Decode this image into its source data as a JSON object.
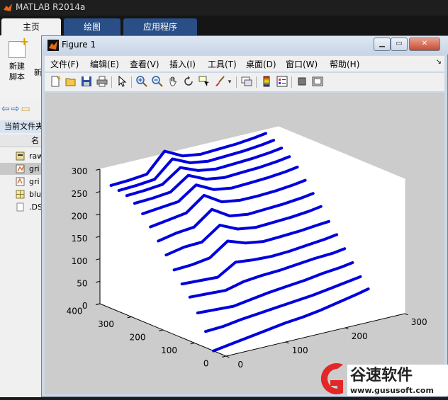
{
  "app": {
    "title": "MATLAB R2014a"
  },
  "ribbon": {
    "tabs": [
      {
        "label": "主页"
      },
      {
        "label": "绘图"
      },
      {
        "label": "应用程序"
      }
    ],
    "new_script": {
      "line1": "新建",
      "line2": "脚本"
    },
    "new_partial": "新"
  },
  "file_browser": {
    "label": "当前文件夹",
    "column_header": "名",
    "files": [
      {
        "name": "raw"
      },
      {
        "name": "gri"
      },
      {
        "name": "gri"
      },
      {
        "name": "blu"
      },
      {
        "name": ".DS"
      }
    ]
  },
  "figure": {
    "title": "Figure 1",
    "window_buttons": {
      "minimize": "▁",
      "restore": "▭",
      "close": "✕"
    },
    "menu": [
      {
        "label": "文件(F)"
      },
      {
        "label": "编辑(E)"
      },
      {
        "label": "查看(V)"
      },
      {
        "label": "插入(I)"
      },
      {
        "label": "工具(T)"
      },
      {
        "label": "桌面(D)"
      },
      {
        "label": "窗口(W)"
      },
      {
        "label": "帮助(H)"
      }
    ],
    "menu_arrow": "↘",
    "toolbar_icons": [
      "new-figure-icon",
      "open-file-icon",
      "save-icon",
      "print-icon",
      "select-arrow-icon",
      "zoom-in-icon",
      "zoom-out-icon",
      "pan-hand-icon",
      "rotate-3d-icon",
      "data-cursor-icon",
      "brush-icon",
      "brush-dropdown-icon",
      "link-plot-icon",
      "colorbar-icon",
      "legend-icon",
      "hide-plot-tools-icon",
      "show-plot-tools-icon"
    ]
  },
  "chart_data": {
    "type": "line",
    "projection": "3d",
    "title": "",
    "xlabel": "",
    "ylabel": "",
    "zlabel": "",
    "x_ticks": [
      "0",
      "100",
      "200",
      "300"
    ],
    "y_ticks": [
      "0",
      "100",
      "200",
      "300",
      "400"
    ],
    "z_ticks": [
      "0",
      "50",
      "100",
      "150",
      "200",
      "250",
      "300"
    ],
    "xlim": [
      0,
      300
    ],
    "ylim": [
      0,
      400
    ],
    "zlim": [
      0,
      300
    ],
    "grid": false,
    "legend": "none",
    "line_color": "#0000dd",
    "series": [
      {
        "y": 40,
        "x": [
          0,
          30,
          60,
          90,
          120,
          150,
          180,
          210,
          240,
          260
        ],
        "z": [
          0,
          6,
          12,
          18,
          24,
          28,
          34,
          42,
          50,
          56
        ]
      },
      {
        "y": 65,
        "x": [
          0,
          30,
          60,
          90,
          120,
          150,
          180,
          210,
          240,
          260
        ],
        "z": [
          36,
          38,
          44,
          48,
          52,
          56,
          60,
          66,
          72,
          76
        ]
      },
      {
        "y": 90,
        "x": [
          0,
          30,
          60,
          90,
          120,
          150,
          180,
          210,
          240,
          260
        ],
        "z": [
          70,
          68,
          66,
          72,
          78,
          82,
          86,
          92,
          96,
          100
        ]
      },
      {
        "y": 115,
        "x": [
          0,
          30,
          60,
          90,
          120,
          150,
          180,
          210,
          240,
          260
        ],
        "z": [
          98,
          96,
          94,
          104,
          108,
          110,
          114,
          118,
          120,
          124
        ]
      },
      {
        "y": 140,
        "x": [
          0,
          30,
          60,
          90,
          120,
          150,
          180,
          210,
          240,
          260
        ],
        "z": [
          120,
          118,
          116,
          140,
          136,
          134,
          136,
          140,
          144,
          148
        ]
      },
      {
        "y": 165,
        "x": [
          0,
          30,
          60,
          90,
          120,
          150,
          180,
          210,
          240,
          260
        ],
        "z": [
          144,
          146,
          152,
          180,
          166,
          160,
          162,
          164,
          168,
          170
        ]
      },
      {
        "y": 190,
        "x": [
          0,
          30,
          60,
          90,
          120,
          150,
          180,
          210,
          240,
          260
        ],
        "z": [
          170,
          178,
          180,
          208,
          190,
          184,
          186,
          188,
          192,
          196
        ]
      },
      {
        "y": 215,
        "x": [
          0,
          30,
          60,
          90,
          120,
          150,
          180,
          210,
          240,
          260
        ],
        "z": [
          194,
          202,
          206,
          236,
          212,
          206,
          208,
          210,
          214,
          218
        ]
      },
      {
        "y": 240,
        "x": [
          0,
          30,
          60,
          90,
          120,
          150,
          180,
          210,
          240,
          260
        ],
        "z": [
          218,
          224,
          230,
          260,
          236,
          230,
          230,
          232,
          236,
          240
        ]
      },
      {
        "y": 265,
        "x": [
          0,
          30,
          60,
          90,
          120,
          150,
          180,
          210,
          240,
          260
        ],
        "z": [
          240,
          244,
          248,
          276,
          256,
          250,
          252,
          254,
          258,
          262
        ]
      },
      {
        "y": 290,
        "x": [
          0,
          30,
          60,
          90,
          120,
          150,
          180,
          210,
          240,
          260
        ],
        "z": [
          256,
          258,
          262,
          290,
          272,
          266,
          268,
          270,
          274,
          278
        ]
      },
      {
        "y": 315,
        "x": [
          0,
          30,
          60,
          90,
          120,
          150,
          180,
          210,
          240,
          260
        ],
        "z": [
          266,
          268,
          272,
          300,
          284,
          278,
          280,
          282,
          286,
          290
        ]
      },
      {
        "y": 340,
        "x": [
          0,
          30,
          60,
          90,
          120,
          150,
          180,
          210,
          240,
          260
        ],
        "z": [
          270,
          272,
          276,
          312,
          294,
          288,
          290,
          292,
          296,
          300
        ]
      },
      {
        "y": 365,
        "x": [
          0,
          30,
          60,
          90,
          120,
          150,
          180,
          210,
          240,
          260
        ],
        "z": [
          274,
          276,
          280,
          322,
          302,
          296,
          298,
          300,
          304,
          308
        ]
      }
    ]
  },
  "watermark": {
    "brand": "谷速软件",
    "url": "www.gususoft.com"
  }
}
